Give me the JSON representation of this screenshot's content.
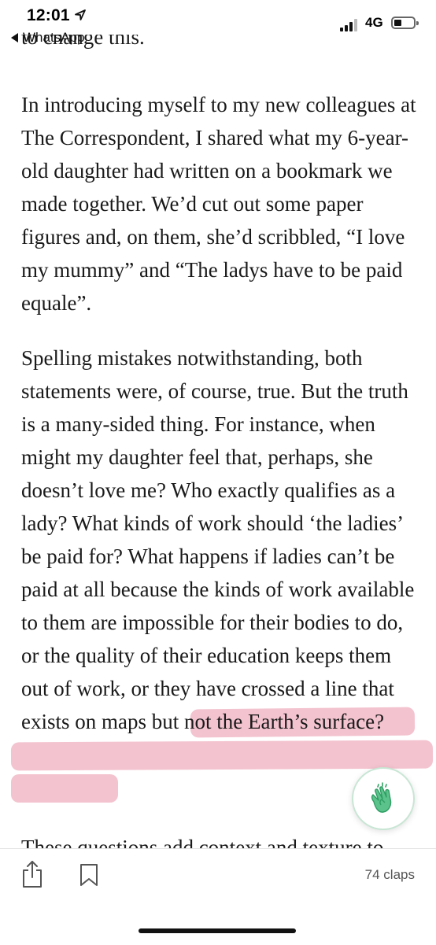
{
  "status_bar": {
    "time": "12:01",
    "back_app": "WhatsApp",
    "network": "4G",
    "icons": [
      "location-arrow-icon",
      "signal-icon",
      "battery-icon"
    ]
  },
  "article": {
    "cut_off_top": "to change this.",
    "paragraph_1": "In introducing myself to my new colleagues at The Correspondent, I shared what my 6-year-old daughter had written on a bookmark we made together. We’d cut out some paper figures and, on them, she’d scribbled, “I love my mummy” and “The ladys have to be paid equale”.",
    "paragraph_2": "Spelling mistakes notwithstanding, both statements were, of course, true. But the truth is a many-sided thing. For instance, when might my daughter feel that, perhaps, she doesn’t love me? Who exactly qualifies as a lady? What kinds of work should ‘the ladies’ be paid for? What happens if ladies can’t be paid at all because the kinds of work available to them are impossible for their bodies to do, or the quality of their education keeps them out of work, or they have crossed a line that exists on maps but not the Earth’s surface?",
    "paragraph_3_cut": "These questions add context and texture to",
    "highlight_color": "#e2718c"
  },
  "clap_button": {
    "icon": "clap-hands-icon",
    "color": "#2e9e63"
  },
  "bottom_bar": {
    "claps_label": "74 claps",
    "icons": [
      "share-icon",
      "bookmark-icon"
    ]
  }
}
